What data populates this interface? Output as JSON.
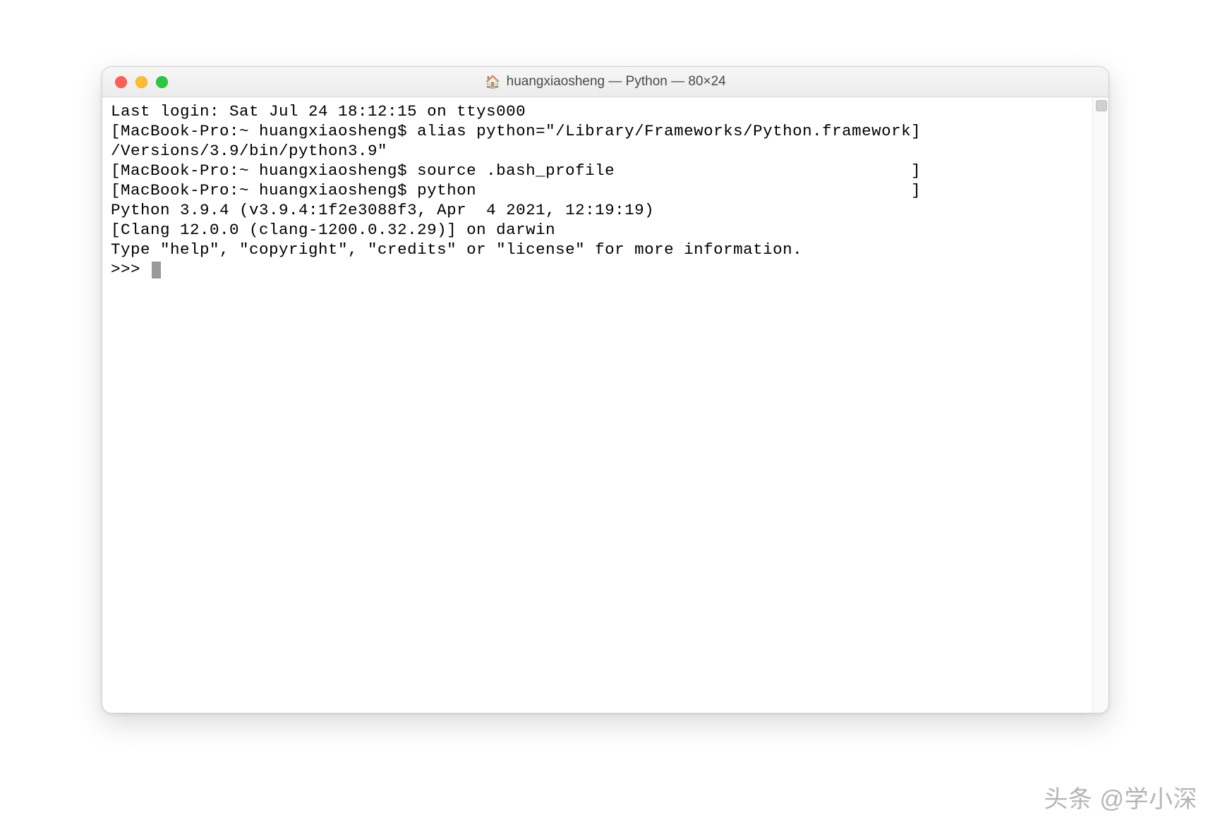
{
  "window": {
    "title": "huangxiaosheng — Python — 80×24"
  },
  "terminal": {
    "lines": [
      "Last login: Sat Jul 24 18:12:15 on ttys000",
      "[MacBook-Pro:~ huangxiaosheng$ alias python=\"/Library/Frameworks/Python.framework]",
      "/Versions/3.9/bin/python3.9\"",
      "[MacBook-Pro:~ huangxiaosheng$ source .bash_profile                              ]",
      "[MacBook-Pro:~ huangxiaosheng$ python                                            ]",
      "Python 3.9.4 (v3.9.4:1f2e3088f3, Apr  4 2021, 12:19:19)",
      "[Clang 12.0.0 (clang-1200.0.32.29)] on darwin",
      "Type \"help\", \"copyright\", \"credits\" or \"license\" for more information."
    ],
    "prompt": ">>> "
  },
  "watermark": "头条 @学小深"
}
